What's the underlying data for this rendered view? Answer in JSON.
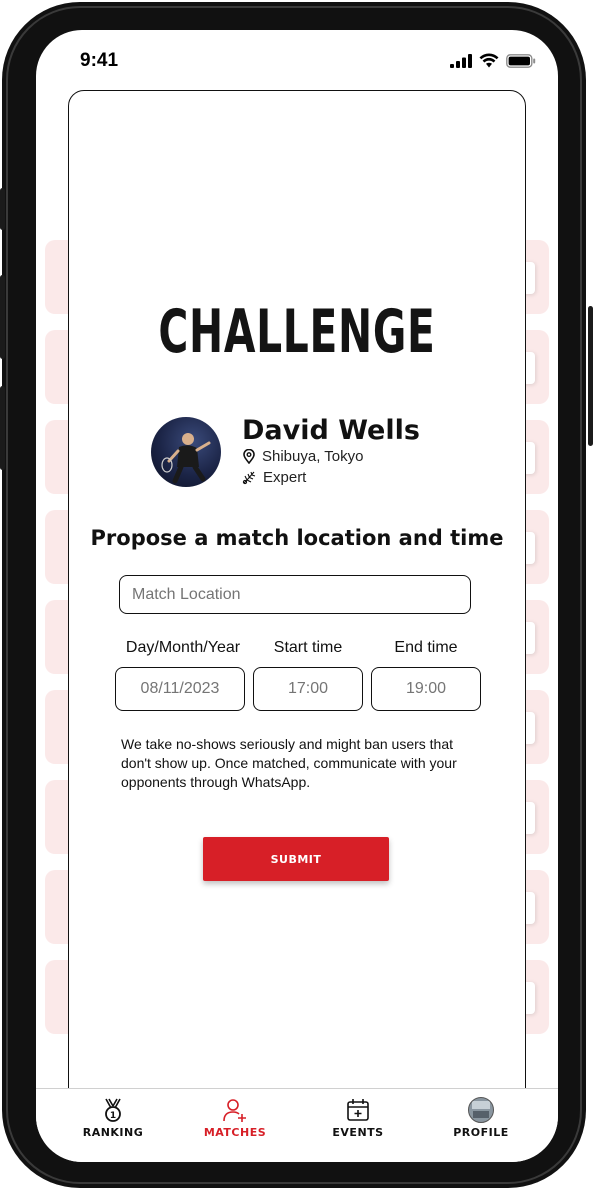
{
  "status_bar": {
    "time": "9:41"
  },
  "modal": {
    "title": "CHALLENGE",
    "opponent": {
      "name": "David Wells",
      "location": "Shibuya, Tokyo",
      "level": "Expert"
    },
    "heading": "Propose a match location and time",
    "location_placeholder": "Match Location",
    "date_label": "Day/Month/Year",
    "start_label": "Start time",
    "end_label": "End time",
    "date_value": "08/11/2023",
    "start_value": "17:00",
    "end_value": "19:00",
    "notice": "We take no-shows seriously and might ban users that don't show up.  Once matched, communicate with your opponents through WhatsApp.",
    "submit_label": "SUBMIT"
  },
  "bottom_nav": {
    "active": "matches",
    "items": [
      {
        "id": "ranking",
        "label": "RANKING",
        "icon": "medal-icon"
      },
      {
        "id": "matches",
        "label": "MATCHES",
        "icon": "add-user-icon"
      },
      {
        "id": "events",
        "label": "EVENTS",
        "icon": "calendar-plus-icon"
      },
      {
        "id": "profile",
        "label": "PROFILE",
        "icon": "profile-avatar"
      }
    ]
  },
  "colors": {
    "accent": "#d71f27",
    "card_background": "#fbe9e9",
    "text": "#111111"
  }
}
